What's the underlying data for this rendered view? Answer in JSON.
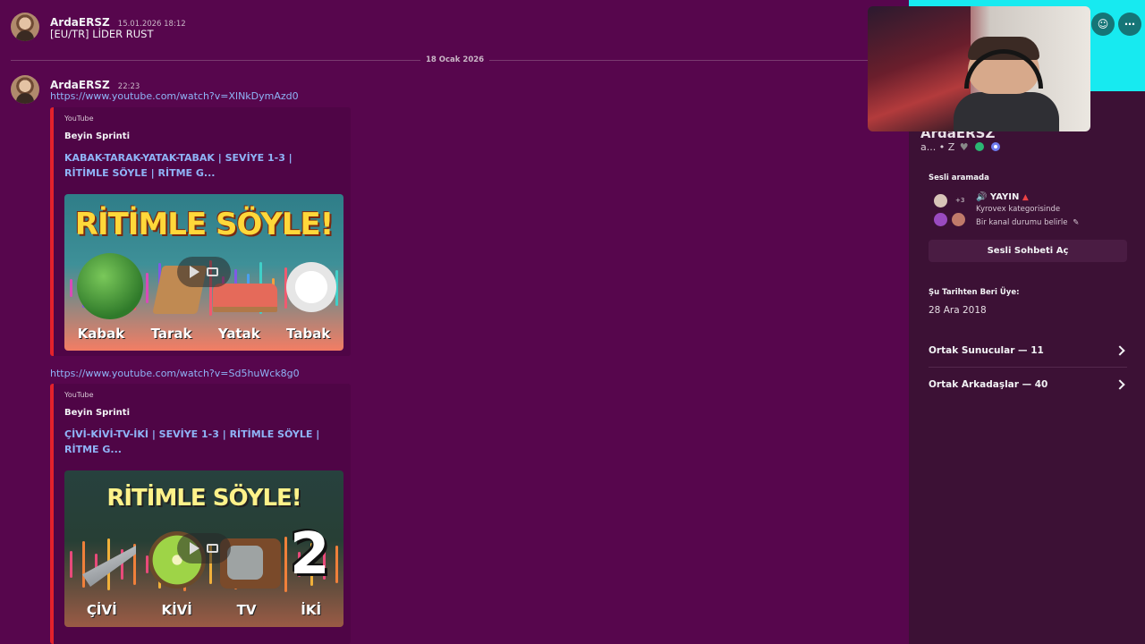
{
  "messages": [
    {
      "author": "ArdaERSZ",
      "time": "15.01.2026 18:12",
      "text": "[EU/TR] LİDER RUST"
    },
    {
      "author": "ArdaERSZ",
      "time": "22:23"
    }
  ],
  "divider": "18 Ocak 2026",
  "links": [
    "https://www.youtube.com/watch?v=XlNkDymAzd0",
    "https://www.youtube.com/watch?v=Sd5huWck8g0"
  ],
  "embeds": [
    {
      "provider": "YouTube",
      "channel": "Beyin Sprinti",
      "title": "KABAK-TARAK-YATAK-TABAK | SEVİYE 1-3 | RİTİMLE SÖYLE | RİTME G...",
      "thumb_heading": "RİTİMLE SÖYLE!",
      "thumb_words": [
        "Kabak",
        "Tarak",
        "Yatak",
        "Tabak"
      ]
    },
    {
      "provider": "YouTube",
      "channel": "Beyin Sprinti",
      "title": "ÇİVİ-KİVİ-TV-İKİ | SEVİYE 1-3 | RİTİMLE SÖYLE | RİTME G...",
      "thumb_heading": "RİTİMLE SÖYLE!",
      "thumb_words": [
        "ÇİVİ",
        "KİVİ",
        "TV",
        "İKİ"
      ],
      "thumb_number": "2"
    }
  ],
  "profile": {
    "name_peek": "ArdaERSZ",
    "status": "a... • Z",
    "voice_heading": "Sesli aramada",
    "voice_title": "🔊 YAYIN",
    "voice_plus": "+3",
    "voice_category": "Kyrovex kategorisinde",
    "voice_status": "Bir kanal durumu belirle",
    "open_voice_button": "Sesli Sohbeti Aç",
    "member_since_heading": "Şu Tarihten Beri Üye:",
    "member_since_date": "28 Ara 2018",
    "mutual_servers": "Ortak Sunucular — 11",
    "mutual_friends": "Ortak Arkadaşlar — 40"
  },
  "colors": {
    "background": "#57064d",
    "banner": "#17eaf0",
    "link": "#8fb4f7",
    "embed_accent": "#e3222b",
    "panel": "#3c1135"
  },
  "icons": [
    "add-friend-icon",
    "more-options-icon",
    "pencil-icon",
    "chevron-right-icon",
    "play-icon",
    "popout-icon"
  ]
}
